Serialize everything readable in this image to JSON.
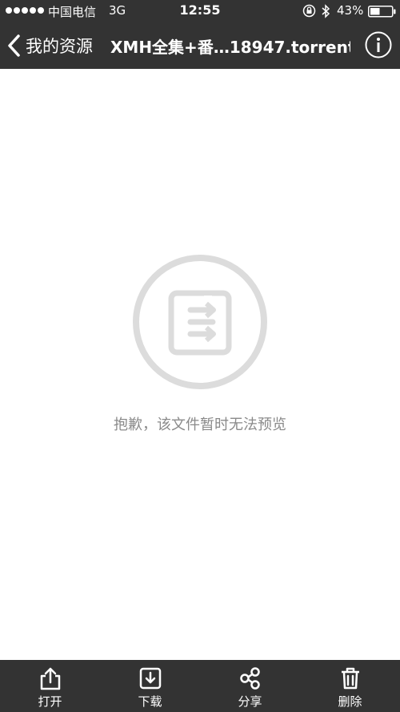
{
  "status_bar": {
    "carrier": "中国电信",
    "network": "3G",
    "time": "12:55",
    "battery": "43%"
  },
  "nav": {
    "back_label": "我的资源",
    "title": "XMH全集+番…18947.torrent"
  },
  "main": {
    "message": "抱歉，该文件暂时无法预览"
  },
  "toolbar": {
    "open_label": "打开",
    "download_label": "下载",
    "share_label": "分享",
    "delete_label": "删除"
  },
  "colors": {
    "bar_background": "#333333",
    "content_background": "#ffffff",
    "placeholder_gray": "#dcdcdc",
    "message_gray": "#8a8a8a"
  },
  "icons": {
    "back": "chevron-left-icon",
    "info": "info-icon",
    "placeholder": "document-icon",
    "open": "share-up-icon",
    "download": "download-icon",
    "share": "share-nodes-icon",
    "delete": "trash-icon"
  }
}
